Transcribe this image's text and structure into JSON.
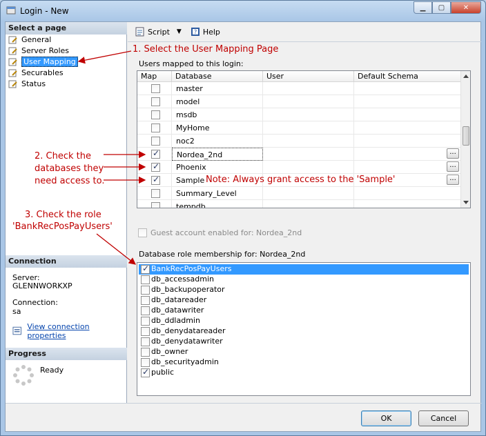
{
  "window": {
    "title": "Login - New"
  },
  "left_pane": {
    "select_page_header": "Select a page",
    "items": [
      {
        "label": "General"
      },
      {
        "label": "Server Roles"
      },
      {
        "label": "User Mapping"
      },
      {
        "label": "Securables"
      },
      {
        "label": "Status"
      }
    ],
    "connection_header": "Connection",
    "server_label": "Server:",
    "server_value": "GLENNWORKXP",
    "connection_label": "Connection:",
    "connection_value": "sa",
    "view_props_link": "View connection properties",
    "progress_header": "Progress",
    "progress_status": "Ready"
  },
  "toolbar": {
    "script_label": "Script",
    "help_label": "Help"
  },
  "mapping": {
    "group_label": "Users mapped to this login:",
    "columns": [
      "Map",
      "Database",
      "User",
      "Default Schema"
    ],
    "rows": [
      {
        "db": "master",
        "checked": false
      },
      {
        "db": "model",
        "checked": false
      },
      {
        "db": "msdb",
        "checked": false
      },
      {
        "db": "MyHome",
        "checked": false
      },
      {
        "db": "noc2",
        "checked": false
      },
      {
        "db": "Nordea_2nd",
        "checked": true
      },
      {
        "db": "Phoenix",
        "checked": true
      },
      {
        "db": "Sample",
        "checked": true
      },
      {
        "db": "Summary_Level",
        "checked": false
      },
      {
        "db": "tempdb",
        "checked": false
      }
    ]
  },
  "guest_label": "Guest account enabled for: Nordea_2nd",
  "role_group_label": "Database role membership for: Nordea_2nd",
  "roles": [
    {
      "name": "BankRecPosPayUsers",
      "checked": true
    },
    {
      "name": "db_accessadmin",
      "checked": false
    },
    {
      "name": "db_backupoperator",
      "checked": false
    },
    {
      "name": "db_datareader",
      "checked": false
    },
    {
      "name": "db_datawriter",
      "checked": false
    },
    {
      "name": "db_ddladmin",
      "checked": false
    },
    {
      "name": "db_denydatareader",
      "checked": false
    },
    {
      "name": "db_denydatawriter",
      "checked": false
    },
    {
      "name": "db_owner",
      "checked": false
    },
    {
      "name": "db_securityadmin",
      "checked": false
    },
    {
      "name": "public",
      "checked": true
    }
  ],
  "buttons": {
    "ok": "OK",
    "cancel": "Cancel"
  },
  "annotations": {
    "step1": "1. Select the User Mapping Page",
    "step2_line1": "2. Check the",
    "step2_line2": "databases they",
    "step2_line3": "need access to.",
    "note": "Note: Always grant access to the 'Sample'",
    "step3_line1": "3. Check the role",
    "step3_line2": "'BankRecPosPayUsers'"
  },
  "colors": {
    "annotation": "#c00000",
    "selection": "#3399ff"
  }
}
